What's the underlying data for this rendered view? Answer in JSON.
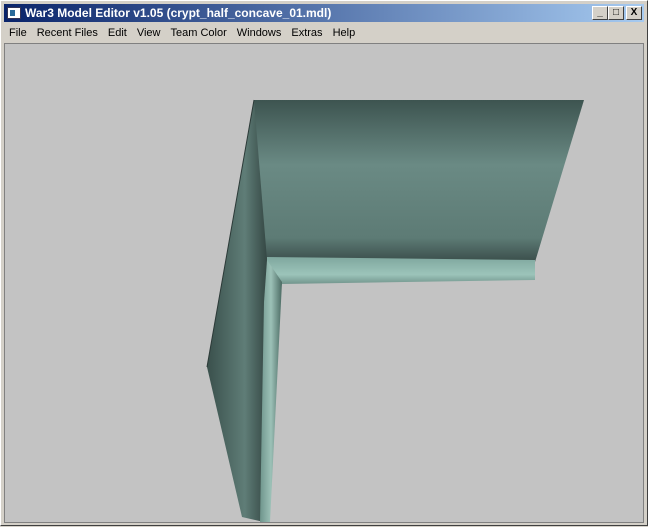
{
  "window": {
    "title": "War3 Model Editor v1.05 (crypt_half_concave_01.mdl)",
    "minimize": "_",
    "maximize": "□",
    "close": "X"
  },
  "menu": [
    "File",
    "Recent Files",
    "Edit",
    "View",
    "Team Color",
    "Windows",
    "Extras",
    "Help"
  ],
  "viewport": {
    "background": "#c3c3c3",
    "model_color": "#4f6c66"
  }
}
